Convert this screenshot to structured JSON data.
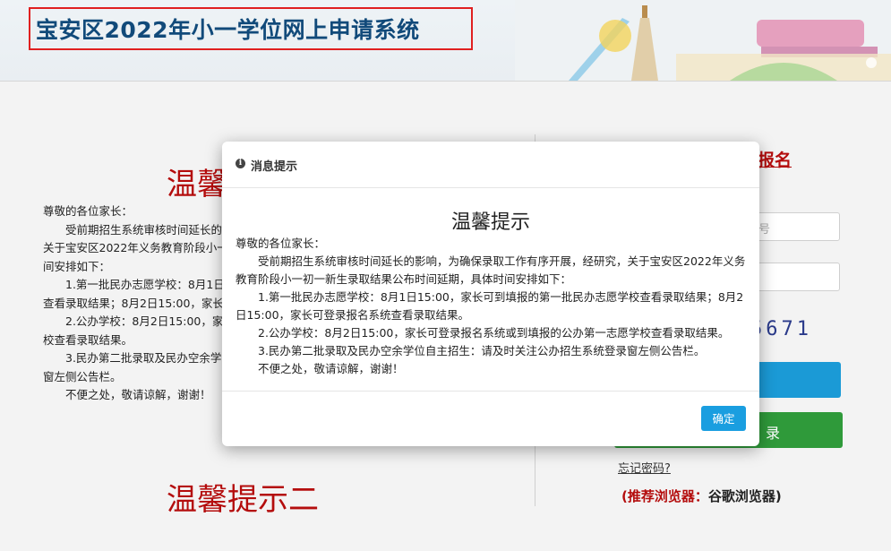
{
  "header": {
    "title": "宝安区2022年小一学位网上申请系统"
  },
  "page": {
    "notice_heading": "温馨",
    "notice_paragraphs": [
      "尊敬的各位家长：",
      "　　受前期招生系统审核时间延长的",
      "关于宝安区2022年义务教育阶段小一",
      "间安排如下：",
      "　　1.第一批民办志愿学校：8月1日",
      "查看录取结果；8月2日15:00，家长",
      "　　2.公办学校：8月2日15:00，家长",
      "校查看录取结果。",
      "　　3.民办第二批录取及民办空余学",
      "窗左侧公告栏。",
      "　　不便之处，敬请谅解，谢谢！"
    ],
    "notice2_heading": "温馨提示二",
    "apply_link": "报名",
    "field1_placeholder": "号",
    "captcha_text": "5671",
    "login_label": "录",
    "forgot_password": "忘记密码?",
    "browser_tip_prefix": "(推荐浏览器：",
    "browser_tip_name": "谷歌浏览器)"
  },
  "modal": {
    "header_title": "消息提示",
    "heading": "温馨提示",
    "paragraphs": [
      "尊敬的各位家长：",
      "受前期招生系统审核时间延长的影响，为确保录取工作有序开展，经研究，关于宝安区2022年义务教育阶段小一初一新生录取结果公布时间延期，具体时间安排如下：",
      "1.第一批民办志愿学校：8月1日15:00，家长可到填报的第一批民办志愿学校查看录取结果；8月2日15:00，家长可登录报名系统查看录取结果。",
      "2.公办学校：8月2日15:00，家长可登录报名系统或到填报的公办第一志愿学校查看录取结果。",
      "3.民办第二批录取及民办空余学位自主招生：请及时关注公办招生系统登录窗左侧公告栏。",
      "不便之处，敬请谅解，谢谢！"
    ],
    "ok_button": "确定"
  }
}
